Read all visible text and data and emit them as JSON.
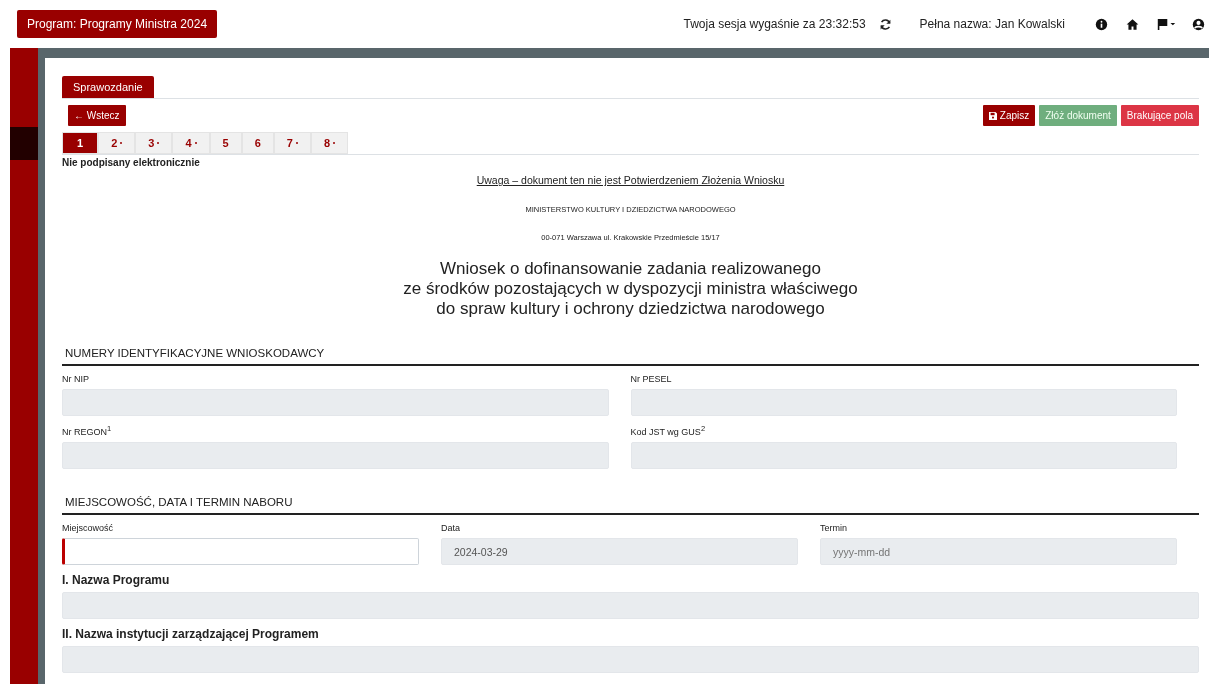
{
  "header": {
    "program": "Program: Programy Ministra 2024",
    "session": "Twoja sesja wygaśnie za 23:32:53",
    "user": "Pełna nazwa: Jan Kowalski"
  },
  "tabs": [
    {
      "label": "Sprawozdanie",
      "selected": true
    }
  ],
  "back_button": "← Wstecz",
  "actions": [
    {
      "label": "Zapisz",
      "kind": "save"
    },
    {
      "label": "Złóż dokument",
      "kind": "submit"
    },
    {
      "label": "Brakujące pola",
      "kind": "missing"
    }
  ],
  "pages": [
    {
      "label": "1",
      "selected": true,
      "marked": false
    },
    {
      "label": "2",
      "selected": false,
      "marked": true
    },
    {
      "label": "3",
      "selected": false,
      "marked": true
    },
    {
      "label": "4",
      "selected": false,
      "marked": true
    },
    {
      "label": "5",
      "selected": false,
      "marked": false
    },
    {
      "label": "6",
      "selected": false,
      "marked": false
    },
    {
      "label": "7",
      "selected": false,
      "marked": true
    },
    {
      "label": "8",
      "selected": false,
      "marked": true
    }
  ],
  "signature_status": "Nie podpisany elektronicznie",
  "notice": "Uwaga – dokument ten nie jest Potwierdzeniem Złożenia Wniosku",
  "ministry": "MINISTERSTWO KULTURY I DZIEDZICTWA NARODOWEGO",
  "address": "00-071 Warszawa ul. Krakowskie Przedmieście 15/17",
  "title_lines": [
    "Wniosek o dofinansowanie zadania realizowanego",
    "ze środków pozostających w dyspozycji ministra właściwego",
    "do spraw kultury i ochrony dziedzictwa narodowego"
  ],
  "sections": [
    {
      "heading": "NUMERY IDENTYFIKACYJNE WNIOSKODAWCY",
      "fields": [
        {
          "label": "Nr NIP",
          "disabled": true,
          "required": false
        },
        {
          "label": "Nr PESEL",
          "disabled": true,
          "required": false
        },
        {
          "label": "Nr REGON$^{1}$",
          "disabled": true,
          "required": false
        },
        {
          "label": "Kod JST wg GUS$^{2}$",
          "disabled": true,
          "required": false
        }
      ]
    },
    {
      "heading": "MIEJSCOWOŚĆ, DATA I TERMIN NABORU",
      "fields": [
        {
          "label": "Miejscowość",
          "disabled": false,
          "required": true
        },
        {
          "label": "Data",
          "value": "2024-03-29",
          "disabled": true,
          "required": false
        },
        {
          "label": "Termin",
          "placeholder": "yyyy-mm-dd",
          "disabled": true,
          "required": false
        }
      ]
    }
  ],
  "blocks": [
    {
      "label": "I. Nazwa Programu",
      "disabled": true
    },
    {
      "label": "II. Nazwa instytucji zarządzającej Programem",
      "disabled": true
    }
  ]
}
